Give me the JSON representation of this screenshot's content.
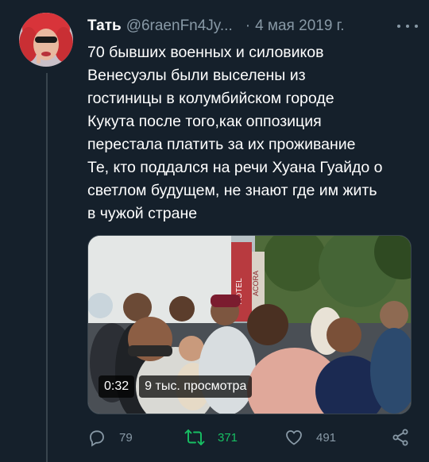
{
  "tweet": {
    "display_name": "Тать",
    "handle": "@6raenFn4Jy...",
    "separator": "·",
    "date": "4 мая 2019 г.",
    "text_lines": [
      "70 бывших военных и силовиков",
      "Венесуэлы были выселены из",
      "гостиницы в  колумбийском городе",
      "Кукута после того,как оппозиция",
      "перестала платить за их проживание",
      "Те, кто поддался на речи Хуана Гуайдо о",
      "светлом будущем, не знают где им жить",
      "в чужой стране"
    ]
  },
  "media": {
    "duration": "0:32",
    "views": "9 тыс. просмотра",
    "sign_text_1": "HOTEL",
    "sign_text_2": "ACORA"
  },
  "actions": {
    "replies": "79",
    "retweets": "371",
    "likes": "491"
  },
  "icons": {
    "reply": "reply-icon",
    "retweet": "retweet-icon",
    "like": "heart-icon",
    "share": "share-icon",
    "more": "more-icon"
  },
  "colors": {
    "background": "#15202b",
    "secondary_text": "#8899a6",
    "retweet_active": "#17bf63"
  }
}
